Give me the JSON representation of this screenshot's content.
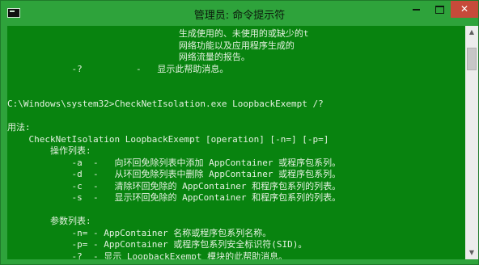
{
  "window": {
    "title": "管理员: 命令提示符",
    "controls": {
      "close": "✕"
    },
    "icons": [
      "cmd-app-icon",
      "minimize-icon",
      "maximize-icon",
      "close-icon",
      "scroll-up-icon",
      "scroll-down-icon"
    ]
  },
  "colors": {
    "console_background": "#08830f",
    "console_text": "#e4f2e0",
    "titlebar": "#2ea33b",
    "close_button": "#c74a3a"
  },
  "console": {
    "lines": [
      "                                生成使用的、未使用的或缺少的t",
      "                                网络功能以及应用程序生成的",
      "                                网络流量的报告。",
      "            -?          -   显示此帮助消息。",
      "",
      "",
      "C:\\Windows\\system32>CheckNetIsolation.exe LoopbackExempt /?",
      "",
      "用法:",
      "    CheckNetIsolation LoopbackExempt [operation] [-n=] [-p=]",
      "        操作列表:",
      "            -a  -   向环回免除列表中添加 AppContainer 或程序包系列。",
      "            -d  -   从环回免除列表中删除 AppContainer 或程序包系列。",
      "            -c  -   清除环回免除的 AppContainer 和程序包系列的列表。",
      "            -s  -   显示环回免除的 AppContainer 和程序包系列的列表。",
      "",
      "        参数列表:",
      "            -n= - AppContainer 名称或程序包系列名称。",
      "            -p= - AppContainer 或程序包系列安全标识符(SID)。",
      "            -?  - 显示 LoopbackExempt 模块的此帮助消息。"
    ]
  },
  "scrollbar": {
    "up_arrow": "▲",
    "down_arrow": "▼"
  }
}
